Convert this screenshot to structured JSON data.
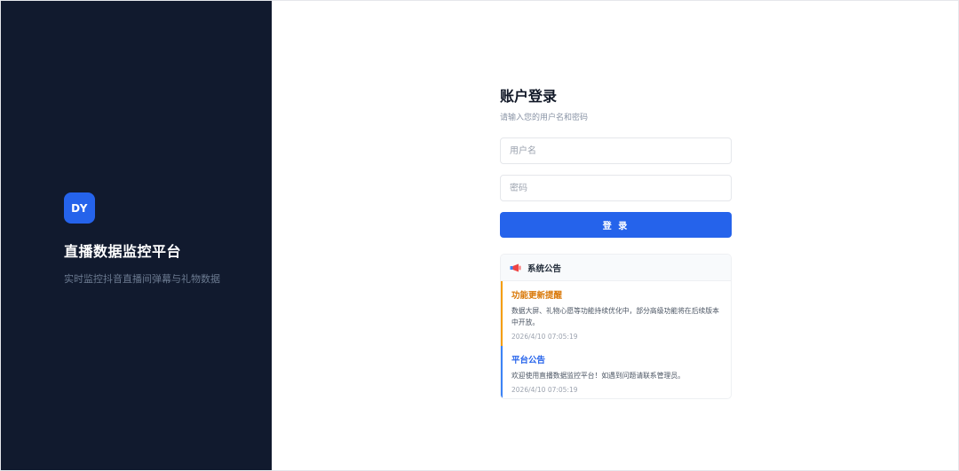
{
  "brand": {
    "logo_text": "DY",
    "title": "直播数据监控平台",
    "subtitle": "实时监控抖音直播间弹幕与礼物数据"
  },
  "login": {
    "title": "账户登录",
    "subtitle": "请输入您的用户名和密码",
    "username_placeholder": "用户名",
    "password_placeholder": "密码",
    "button_label": "登 录"
  },
  "notices": {
    "header_icon": "megaphone-icon",
    "header_title": "系统公告",
    "items": [
      {
        "title": "功能更新提醒",
        "body": "数据大屏、礼物心愿等功能持续优化中，部分高级功能将在后续版本中开放。",
        "time": "2026/4/10 07:05:19",
        "color": "#f59e0b"
      },
      {
        "title": "平台公告",
        "body": "欢迎使用直播数据监控平台！如遇到问题请联系管理员。",
        "time": "2026/4/10 07:05:19",
        "color": "#3b82f6"
      }
    ]
  },
  "colors": {
    "sidebar_bg": "#111a2e",
    "accent": "#2563eb"
  }
}
